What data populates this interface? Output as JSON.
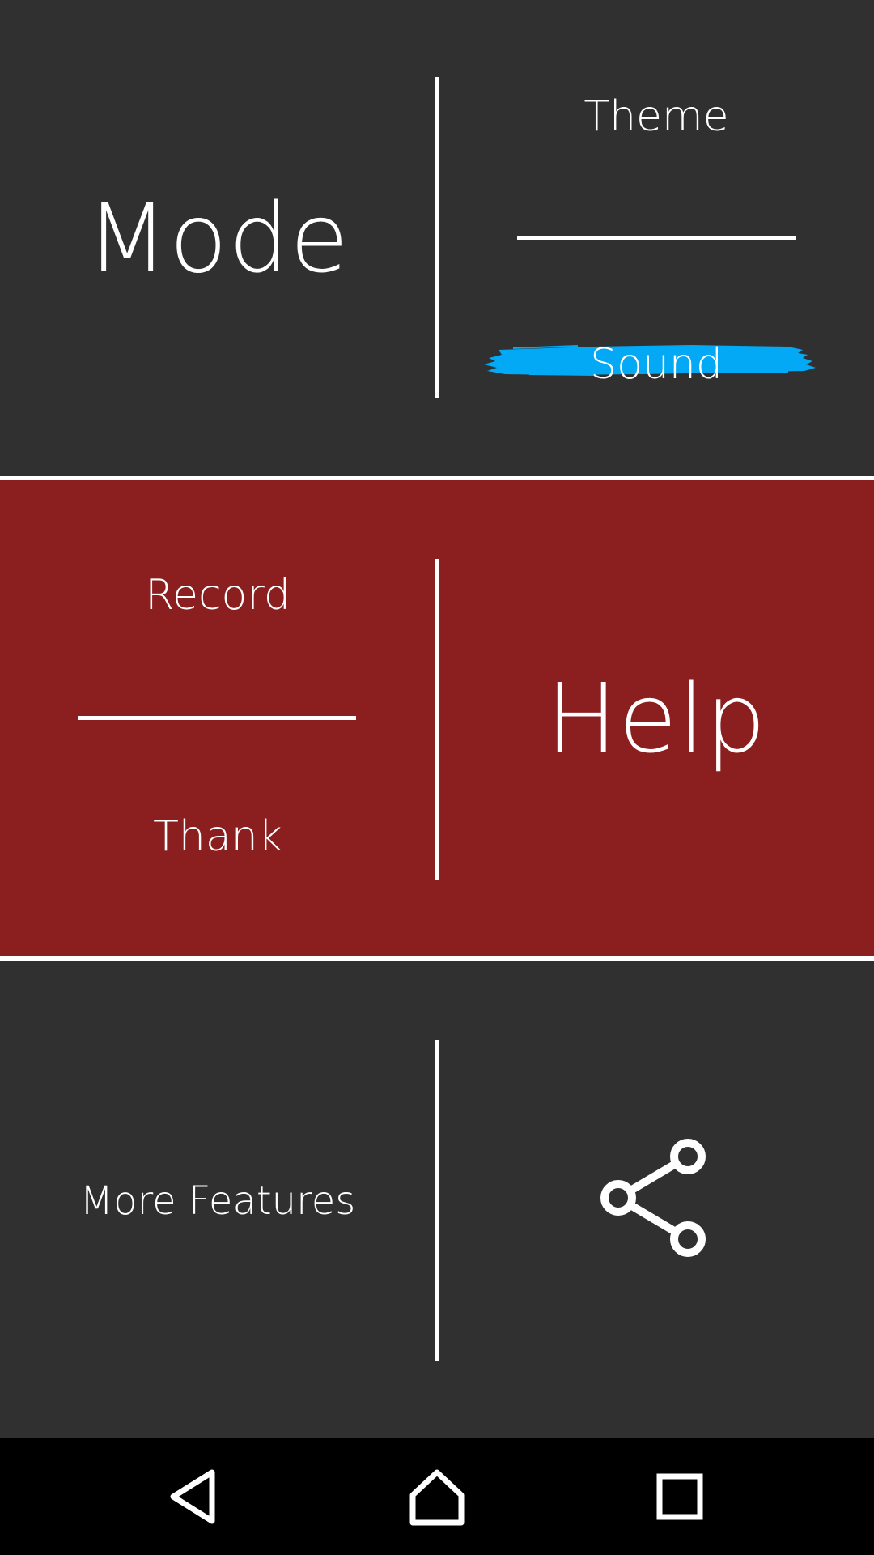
{
  "menu": {
    "mode": {
      "label": "Mode"
    },
    "theme": {
      "label": "Theme"
    },
    "sound": {
      "label": "Sound",
      "highlight_color": "#03a9f4"
    },
    "record": {
      "label": "Record"
    },
    "thank": {
      "label": "Thank"
    },
    "help": {
      "label": "Help"
    },
    "more_features": {
      "label": "More Features"
    },
    "share": {
      "icon": "share-icon"
    }
  },
  "colors": {
    "background": "#303030",
    "accent_red": "#8b1e1f",
    "highlight_blue": "#03a9f4",
    "navbar": "#000000",
    "foreground": "#ffffff"
  },
  "navbar": {
    "buttons": [
      {
        "icon": "back-icon"
      },
      {
        "icon": "home-icon"
      },
      {
        "icon": "recents-icon"
      }
    ]
  }
}
